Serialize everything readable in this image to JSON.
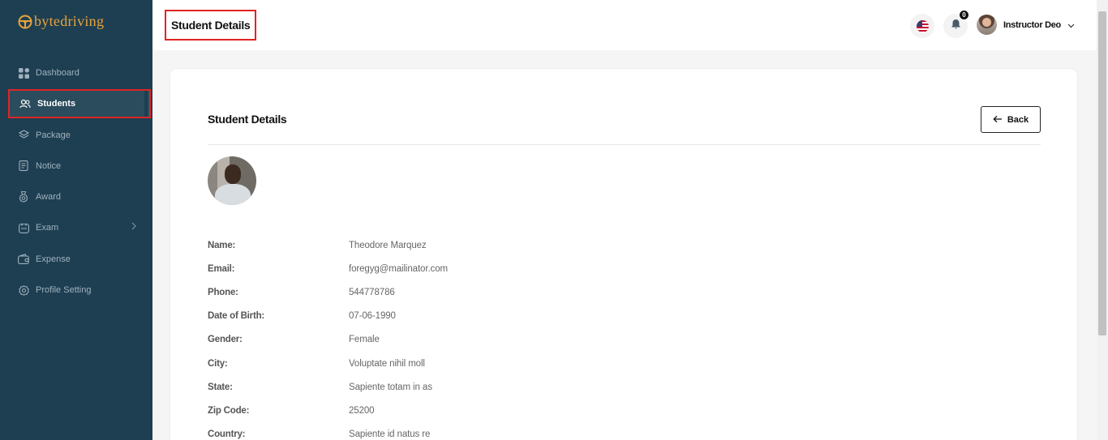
{
  "brand": {
    "name": "bytedriving"
  },
  "sidebar": {
    "items": [
      {
        "label": "Dashboard",
        "icon": "dashboard-icon"
      },
      {
        "label": "Students",
        "icon": "users-icon"
      },
      {
        "label": "Package",
        "icon": "layers-icon"
      },
      {
        "label": "Notice",
        "icon": "document-icon"
      },
      {
        "label": "Award",
        "icon": "award-icon"
      },
      {
        "label": "Exam",
        "icon": "exam-icon"
      },
      {
        "label": "Expense",
        "icon": "wallet-icon"
      },
      {
        "label": "Profile Setting",
        "icon": "gear-icon"
      }
    ],
    "active": "Students"
  },
  "header": {
    "title": "Student Details",
    "notification_count": "0",
    "user_name": "Instructor Deo"
  },
  "card": {
    "title": "Student Details",
    "back_label": "Back"
  },
  "student": {
    "fields": [
      {
        "label": "Name:",
        "value": "Theodore Marquez"
      },
      {
        "label": "Email:",
        "value": "foregyg@mailinator.com"
      },
      {
        "label": "Phone:",
        "value": "544778786"
      },
      {
        "label": "Date of Birth:",
        "value": "07-06-1990"
      },
      {
        "label": "Gender:",
        "value": "Female"
      },
      {
        "label": "City:",
        "value": "Voluptate nihil moll"
      },
      {
        "label": "State:",
        "value": "Sapiente totam in as"
      },
      {
        "label": "Zip Code:",
        "value": "25200"
      },
      {
        "label": "Country:",
        "value": "Sapiente id natus re"
      }
    ]
  },
  "colors": {
    "sidebar_bg": "#1e3f52",
    "brand_accent": "#e8a33c",
    "highlight_border": "#e02424"
  }
}
